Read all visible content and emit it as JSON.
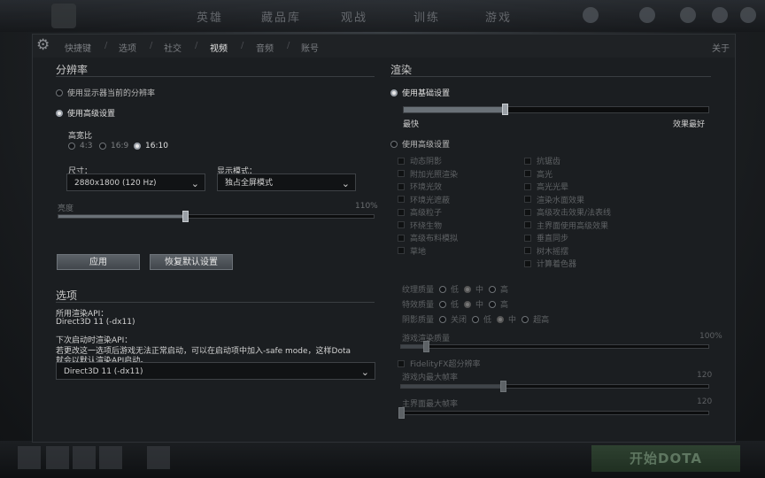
{
  "top_nav": [
    "英雄",
    "藏品库",
    "观战",
    "训练",
    "游戏"
  ],
  "bottom": {
    "play_label": "开始DOTA"
  },
  "tabs": {
    "items": [
      "快捷键",
      "选项",
      "社交",
      "视频",
      "音频",
      "账号"
    ],
    "active": "视频",
    "about_label": "关于"
  },
  "resolution": {
    "title": "分辨率",
    "use_monitor_label": "使用显示器当前的分辨率",
    "use_advanced_label": "使用高级设置",
    "aspect_title": "高宽比",
    "aspect_options": [
      "4:3",
      "16:9",
      "16:10"
    ],
    "aspect_selected": "16:10",
    "size_label": "尺寸：",
    "size_value": "2880x1800 (120 Hz)",
    "display_mode_label": "显示模式：",
    "display_mode_value": "独占全屏模式",
    "brightness_label": "亮度",
    "brightness_value": "110%",
    "brightness_fraction": 0.4,
    "apply_label": "应用",
    "reset_label": "恢复默认设置"
  },
  "options": {
    "title": "选项",
    "api_label": "所用渲染API：",
    "api_value": "Direct3D 11 (-dx11)",
    "next_label": "下次启动时渲染API：",
    "next_note_line1": "若更改这一选项后游戏无法正常启动，可以在启动项中加入-safe mode，这样Dota",
    "next_note_line2": "就会以默认渲染API启动。",
    "next_select_value": "Direct3D 11 (-dx11)"
  },
  "render": {
    "title": "渲染",
    "basic_label": "使用基础设置",
    "quality_fraction": 0.33,
    "fastest_label": "最快",
    "best_label": "效果最好",
    "advanced_label": "使用高级设置",
    "checks_left": [
      "动态阴影",
      "附加光照渲染",
      "环境光效",
      "环境光遮蔽",
      "高级粒子",
      "环绕生物",
      "高级布料模拟",
      "草地"
    ],
    "checks_right": [
      "抗锯齿",
      "高光",
      "高光光晕",
      "渲染水面效果",
      "高级攻击效果/法表线",
      "主界面使用高级效果",
      "垂直同步",
      "树木摇摆",
      "计算着色器"
    ],
    "texture_label": "纹理质量",
    "effects_label": "特效质量",
    "shadow_label": "阴影质量",
    "low": "低",
    "mid": "中",
    "high": "高",
    "off": "关闭",
    "ultra": "超高",
    "game_render_label": "游戏渲染质量",
    "game_render_value": "100%",
    "game_render_fraction": 0.08,
    "fidelity_label": "FidelityFX超分辨率",
    "fps_label": "游戏内最大帧率",
    "fps_value": "120",
    "fps_fraction": 0.33,
    "menu_fps_label": "主界面最大帧率",
    "menu_fps_value": "120",
    "menu_fps_fraction": 0.0
  }
}
